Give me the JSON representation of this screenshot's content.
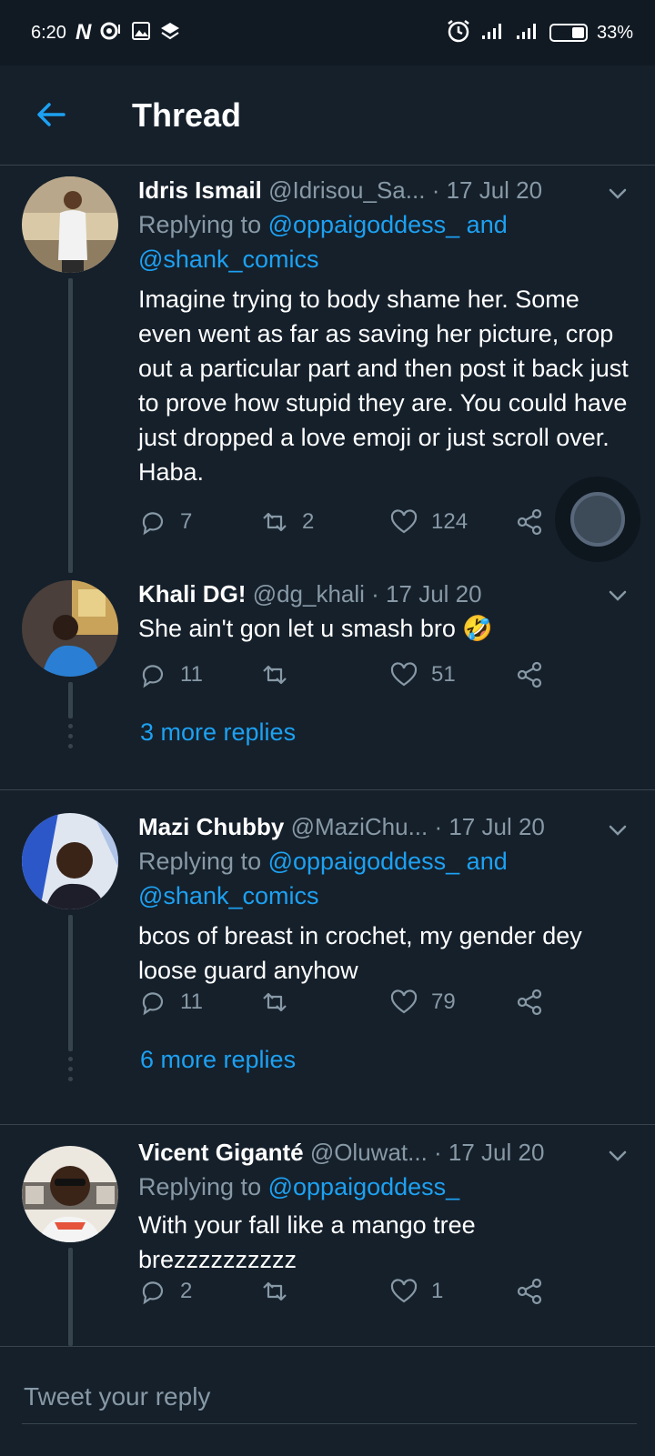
{
  "status_bar": {
    "time": "6:20",
    "battery": "33%",
    "left_icons": [
      "netflix-icon",
      "notification-icon",
      "image-icon",
      "layers-icon"
    ],
    "right_icons": [
      "alarm-icon",
      "signal-icon",
      "signal-icon",
      "battery-icon"
    ]
  },
  "header": {
    "title": "Thread"
  },
  "colors": {
    "background": "#15202b",
    "link": "#1da1f2",
    "muted": "#8899a6",
    "divider": "#38444d"
  },
  "tweets": [
    {
      "name": "Idris Ismail",
      "handle": "@Idrisou_Sa...",
      "date": "· 17 Jul 20",
      "replying_prefix": "Replying to",
      "replying_links": "@oppaigoddess_ and",
      "replying_links2": "@shank_comics",
      "text": "Imagine trying to body shame her. Some even went as far as saving her picture, crop out a particular part and then post it back just to prove how stupid they are. You could have just dropped a love emoji or just scroll over. Haba.",
      "replies": "7",
      "retweets": "2",
      "likes": "124"
    },
    {
      "name": "Khali DG!",
      "handle": "@dg_khali",
      "date": "· 17 Jul 20",
      "text": "She ain't gon let u smash bro 🤣",
      "replies": "11",
      "retweets": "",
      "likes": "51",
      "more_replies": "3 more replies"
    },
    {
      "name": "Mazi Chubby",
      "handle": "@MaziChu...",
      "date": "· 17 Jul 20",
      "replying_prefix": "Replying to",
      "replying_links": "@oppaigoddess_ and",
      "replying_links2": "@shank_comics",
      "text": "bcos of breast in crochet, my gender dey loose guard anyhow",
      "replies": "11",
      "retweets": "",
      "likes": "79",
      "more_replies": "6 more replies"
    },
    {
      "name": "Vicent Giganté",
      "handle": "@Oluwat...",
      "date": "· 17 Jul 20",
      "replying_prefix": "Replying to",
      "replying_links": "@oppaigoddess_",
      "text": "With your fall like a mango tree brezzzzzzzzzz",
      "replies": "2",
      "retweets": "",
      "likes": "1"
    }
  ],
  "compose": {
    "placeholder": "Tweet your reply"
  }
}
